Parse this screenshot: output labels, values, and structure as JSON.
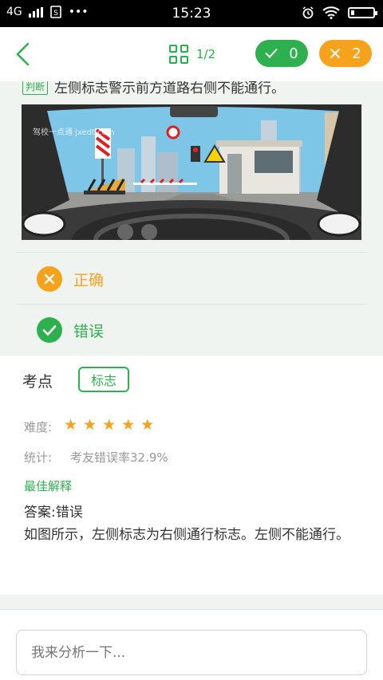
{
  "status": {
    "network": "4G",
    "time": "15:23"
  },
  "nav": {
    "pager": "1/2",
    "correct_count": "0",
    "wrong_count": "2"
  },
  "question": {
    "type_tag": "判断",
    "text": "左侧标志警示前方道路右侧不能通行。",
    "watermark": "驾校一点通 jxedt.com"
  },
  "options": [
    {
      "label": "正确",
      "state": "wrong",
      "color": "#f7a21c",
      "icon": "close-icon"
    },
    {
      "label": "错误",
      "state": "correct",
      "color": "#2fb04f",
      "icon": "check-icon"
    }
  ],
  "analysis": {
    "kp_title": "考点",
    "kp_tag": "标志",
    "difficulty_label": "难度:",
    "difficulty_stars": 5,
    "stat_label": "统计:",
    "stat_value": "考友错误率32.9%",
    "best_title": "最佳解释",
    "answer": "答案:错误",
    "explanation": "如图所示，左侧标志为右侧通行标志。左侧不能通行。"
  },
  "comment": {
    "placeholder": "我来分析一下..."
  },
  "colors": {
    "green": "#2fb04f",
    "orange": "#f7a21c",
    "panel": "#eff4f1"
  }
}
